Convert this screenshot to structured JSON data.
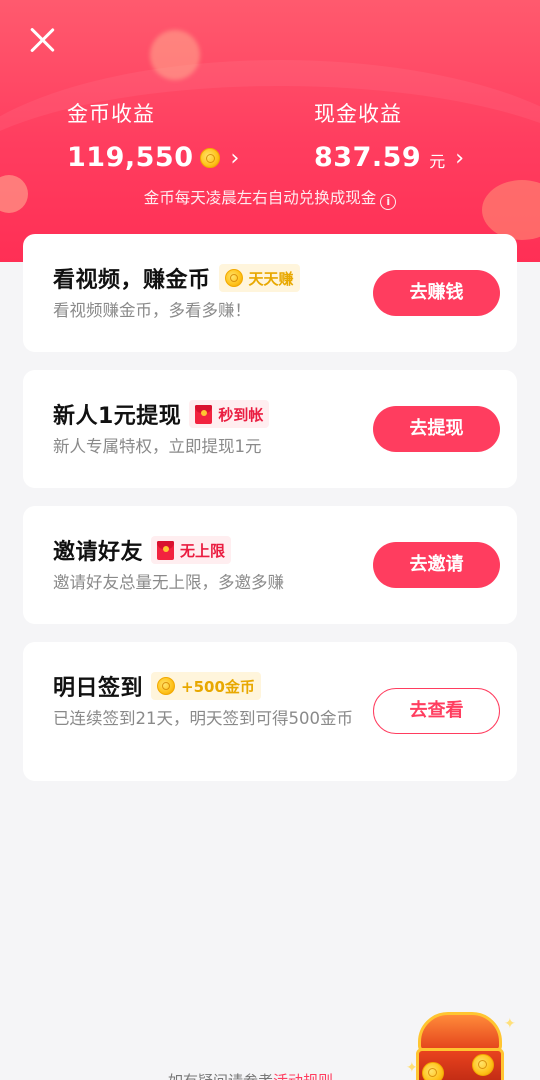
{
  "header": {
    "close_icon": "close-icon",
    "gold_earnings": {
      "label": "金币收益",
      "amount": "119,550",
      "chevron": "›"
    },
    "cash_earnings": {
      "label": "现金收益",
      "amount": "837.59",
      "unit": "元",
      "chevron": "›"
    },
    "notice": "金币每天凌晨左右自动兑换成现金",
    "info_glyph": "i"
  },
  "tasks": [
    {
      "title": "看视频，赚金币",
      "tag": "天天赚",
      "tag_style": "gold",
      "desc": "看视频赚金币，多看多赚！",
      "button": "去赚钱",
      "button_style": "solid"
    },
    {
      "title": "新人1元提现",
      "tag": "秒到帐",
      "tag_style": "red",
      "desc": "新人专属特权，立即提现1元",
      "button": "去提现",
      "button_style": "solid"
    },
    {
      "title": "邀请好友",
      "tag": "无上限",
      "tag_style": "red",
      "desc": "邀请好友总量无上限，多邀多赚",
      "button": "去邀请",
      "button_style": "solid"
    },
    {
      "title": "明日签到",
      "tag": "+500金币",
      "tag_style": "gold",
      "desc": "已连续签到21天，明天签到可得500金币",
      "button": "去查看",
      "button_style": "outline"
    }
  ],
  "footer": {
    "text": "如有疑问请参考",
    "link": "活动规则"
  },
  "colors": {
    "accent": "#ff3d5f",
    "gold": "#e8a800",
    "header_top": "#ff5a6e"
  }
}
